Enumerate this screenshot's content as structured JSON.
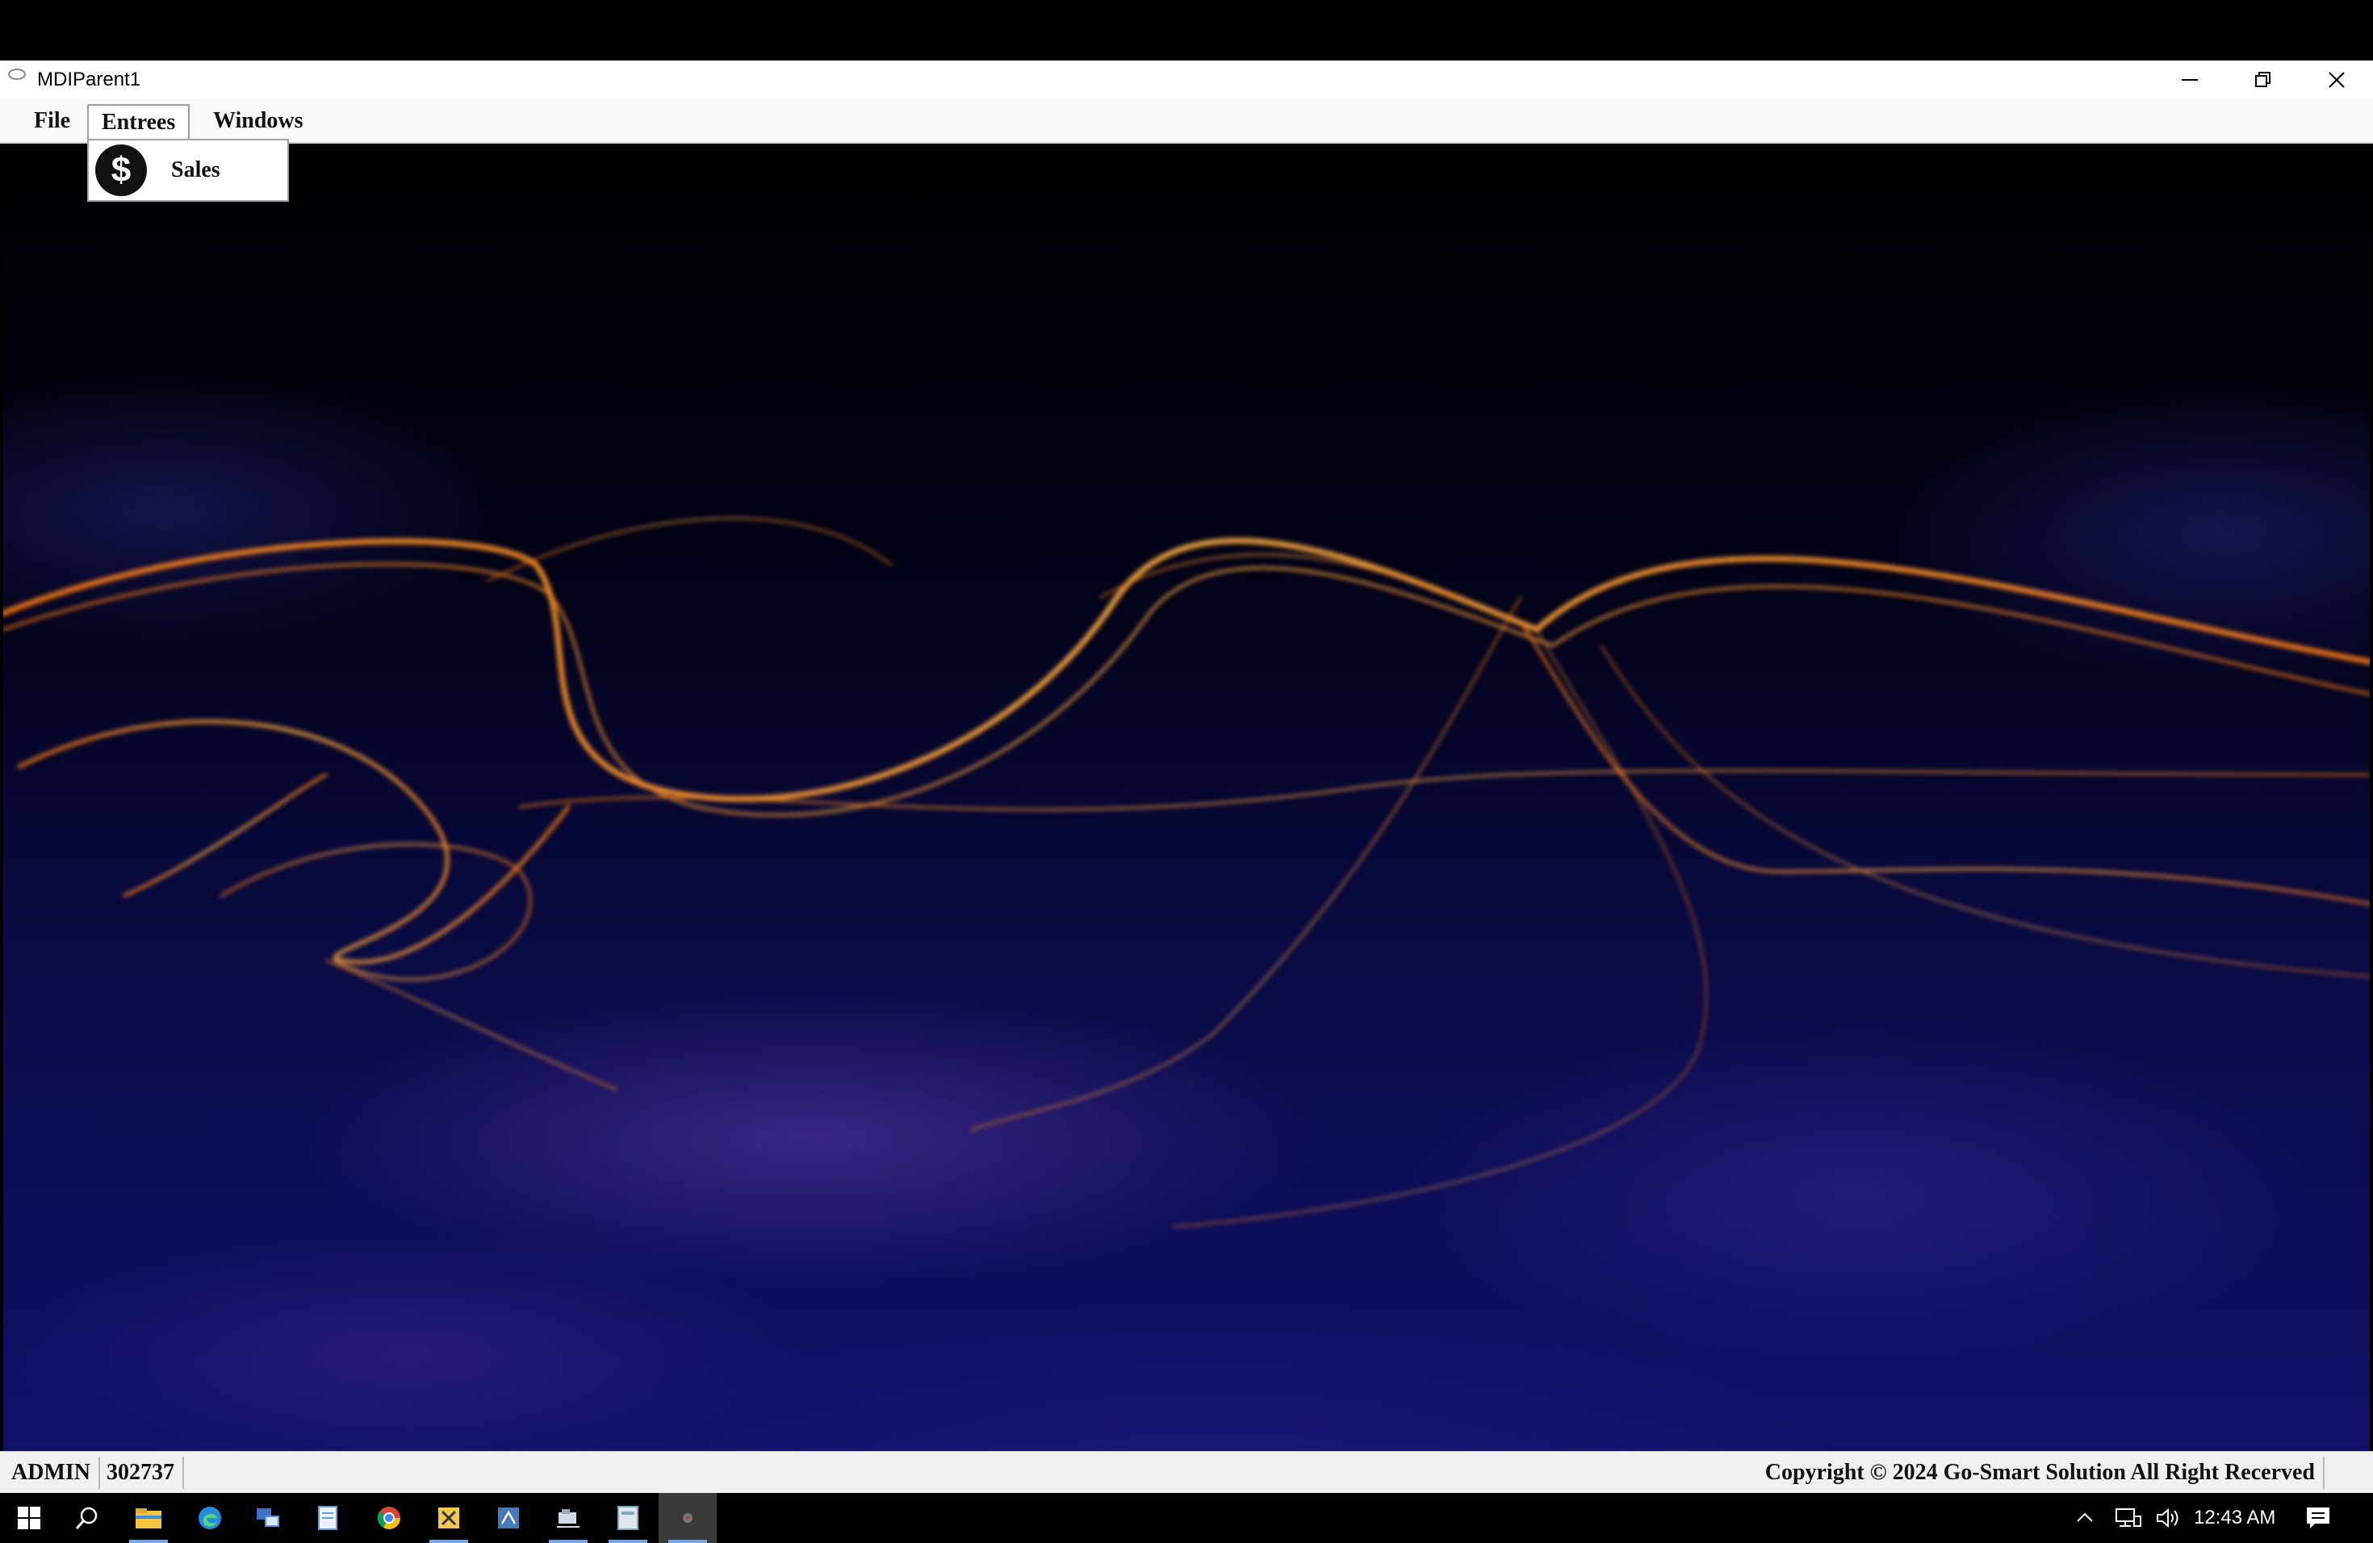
{
  "window": {
    "title": "MDIParent1",
    "controls": [
      "minimize-icon",
      "restore-icon",
      "close-icon"
    ]
  },
  "menu": {
    "items": [
      {
        "label": "File"
      },
      {
        "label": "Entrees"
      },
      {
        "label": "Windows"
      }
    ],
    "open_menu": "Entrees",
    "dropdown": {
      "items": [
        {
          "label": "Sales",
          "icon": "dollar-icon"
        }
      ]
    }
  },
  "status": {
    "user": "ADMIN",
    "code": "302737",
    "copyright": "Copyright © 2024 Go-Smart Solution All Right Recerved"
  },
  "taskbar": {
    "icons": [
      "windows-start-icon",
      "search-icon",
      "file-explorer-icon",
      "edge-icon",
      "network-app-icon",
      "notepad-icon",
      "chrome-icon",
      "tools-app-icon",
      "sql-app-icon",
      "app-icon",
      "notes-app-icon",
      "mdi-app-icon"
    ],
    "clock": "12:43 AM",
    "tray": [
      "chevron-up-icon",
      "network-icon",
      "volume-icon",
      "notification-icon"
    ]
  },
  "colors": {
    "accent_underline": "#7aa7d8",
    "flame": "#ff8a1e",
    "wallpaper_deep_blue": "#10106a"
  }
}
